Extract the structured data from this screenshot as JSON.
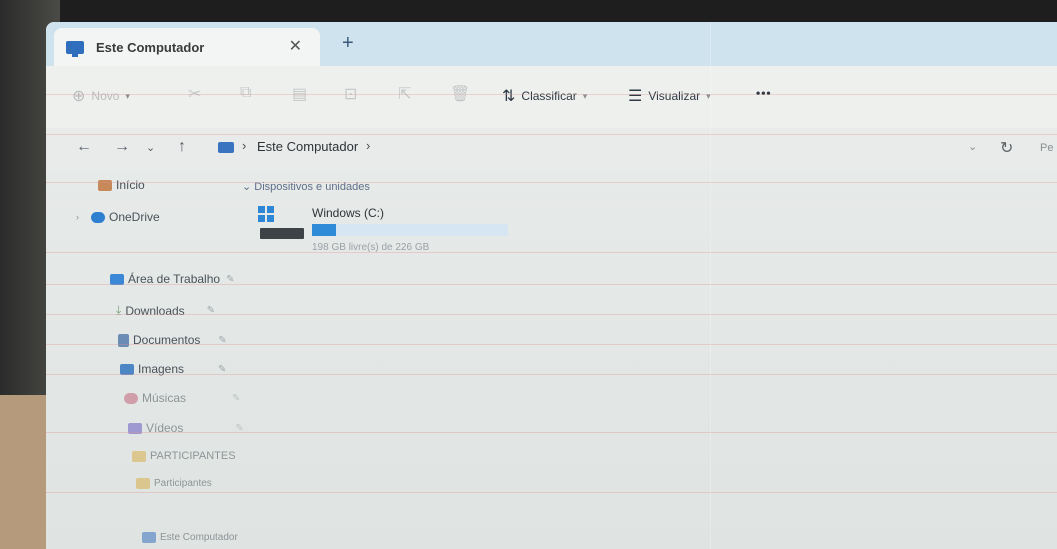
{
  "tab": {
    "title": "Este Computador",
    "close": "✕",
    "new": "+"
  },
  "commands": {
    "new_label": "Novo",
    "sort_label": "Classificar",
    "view_label": "Visualizar",
    "more_label": "•••"
  },
  "address": {
    "path": "Este Computador",
    "search_partial": "Pe"
  },
  "sidebar": {
    "items": [
      {
        "label": "Início",
        "pin": ""
      },
      {
        "label": "OneDrive",
        "pin": ""
      },
      {
        "label": "Área de Trabalho",
        "pin": "✎"
      },
      {
        "label": "Downloads",
        "pin": "✎"
      },
      {
        "label": "Documentos",
        "pin": "✎"
      },
      {
        "label": "Imagens",
        "pin": "✎"
      },
      {
        "label": "Músicas",
        "pin": "✎"
      },
      {
        "label": "Vídeos",
        "pin": "✎"
      },
      {
        "label": "PARTICIPANTES",
        "pin": ""
      },
      {
        "label": "Participantes",
        "pin": ""
      },
      {
        "label": "Este Computador",
        "pin": ""
      }
    ]
  },
  "main": {
    "group_header": "Dispositivos e unidades",
    "drive": {
      "name": "Windows (C:)",
      "space": "198 GB livre(s) de 226 GB",
      "used_fraction": 0.124
    }
  },
  "colors": {
    "accent": "#2f8ad8",
    "tabbar": "#cfe3ee"
  }
}
